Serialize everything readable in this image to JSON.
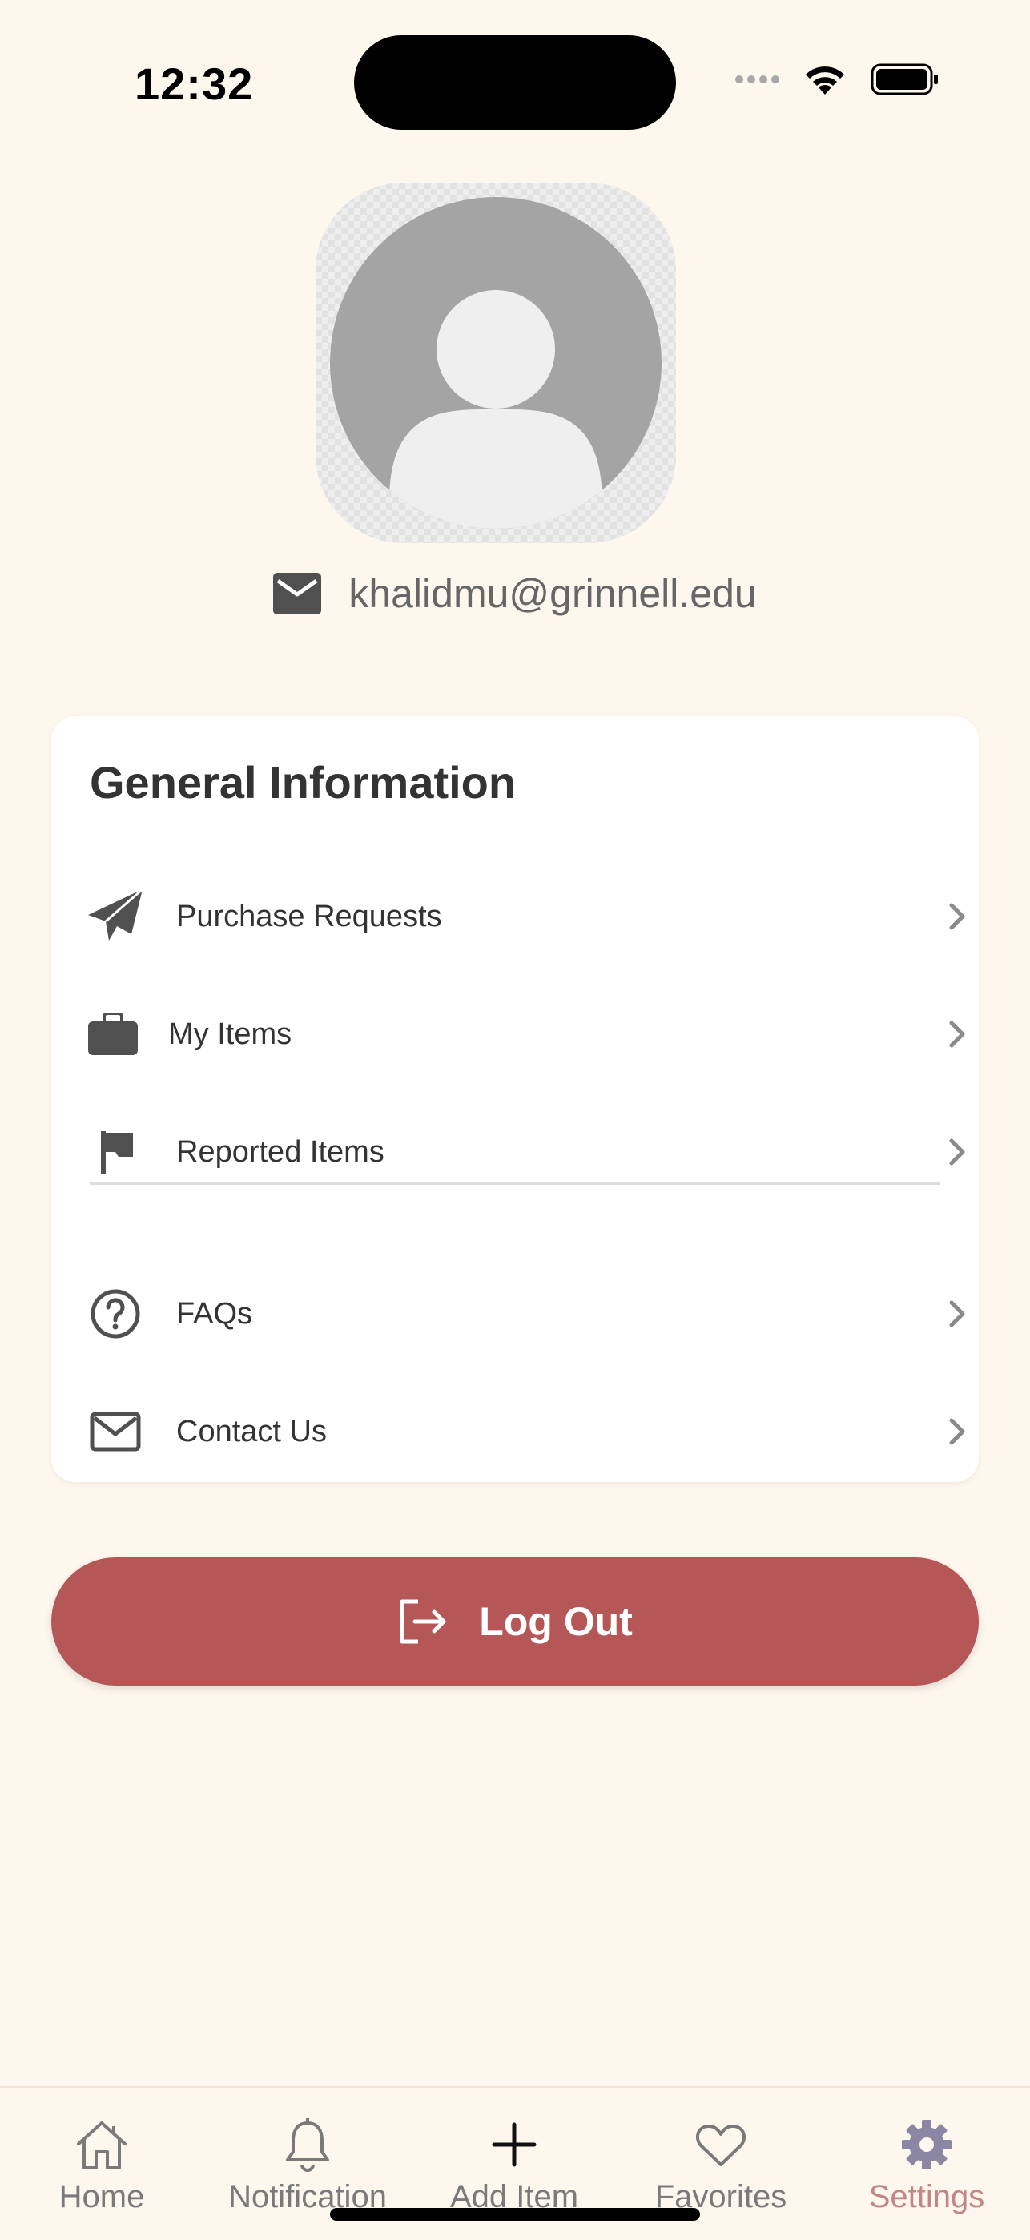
{
  "status_bar": {
    "time": "12:32"
  },
  "profile": {
    "email": "khalidmu@grinnell.edu"
  },
  "general_information": {
    "title": "General Information",
    "items": [
      {
        "label": "Purchase Requests",
        "icon": "paper-plane-icon"
      },
      {
        "label": "My Items",
        "icon": "briefcase-icon"
      },
      {
        "label": "Reported Items",
        "icon": "flag-icon"
      },
      {
        "label": "FAQs",
        "icon": "question-circle-icon"
      },
      {
        "label": "Contact Us",
        "icon": "envelope-outline-icon"
      }
    ]
  },
  "logout": {
    "label": "Log Out"
  },
  "tab_bar": {
    "tabs": [
      {
        "label": "Home",
        "icon": "home-icon"
      },
      {
        "label": "Notification",
        "icon": "bell-icon"
      },
      {
        "label": "Add Item",
        "icon": "plus-icon"
      },
      {
        "label": "Favorites",
        "icon": "heart-icon"
      },
      {
        "label": "Settings",
        "icon": "gear-icon",
        "active": true
      }
    ]
  },
  "colors": {
    "background": "#FEF7EE",
    "accent": "#B55757",
    "active_tab": "#C48585",
    "text_primary": "#333333",
    "text_secondary": "#666666"
  }
}
